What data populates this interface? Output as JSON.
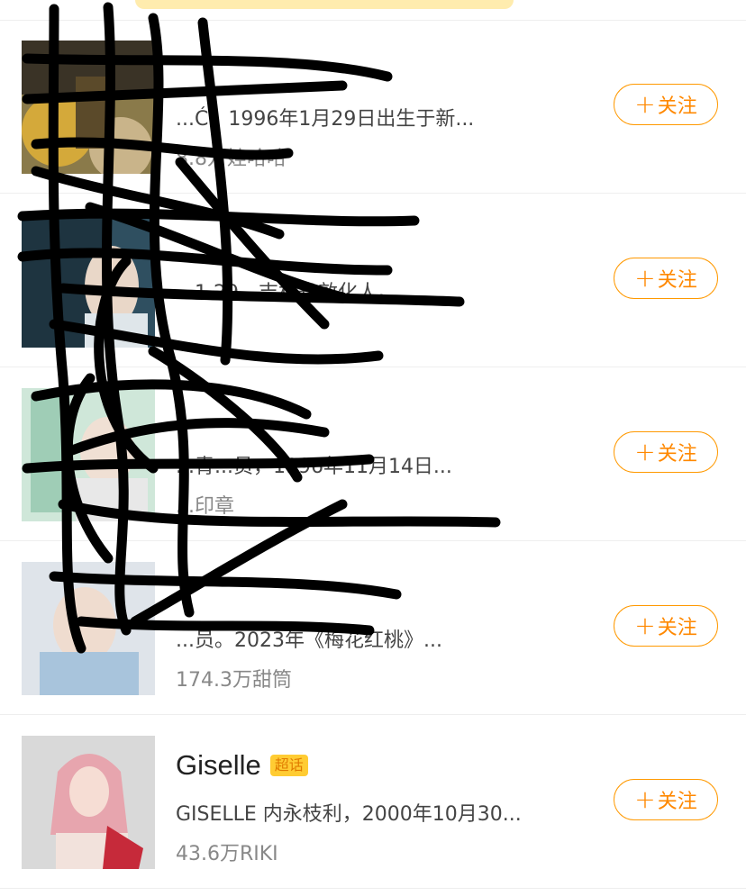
{
  "items": [
    {
      "name": "",
      "badge": "",
      "desc": "...Ć，1996年1月29日出生于新...",
      "meta": "8.8万娃哈哈",
      "follow_label": "关注"
    },
    {
      "name": "",
      "badge": "",
      "desc": "...1.29。吉林省敦化人。...",
      "meta": "",
      "follow_label": "关注"
    },
    {
      "name": "",
      "badge": "",
      "desc": "...青...员，1996年11月14日...",
      "meta": "...印章",
      "follow_label": "关注"
    },
    {
      "name": "",
      "badge": "",
      "desc": "...员。2023年《梅花红桃》...",
      "meta": "174.3万甜筒",
      "follow_label": "关注"
    },
    {
      "name": "Giselle",
      "badge": "超话",
      "desc": "GISELLE 内永枝利，2000年10月30...",
      "meta": "43.6万RIKI",
      "follow_label": "关注"
    }
  ],
  "colors": {
    "accent": "#ff9900",
    "badge_bg": "#ffcc33",
    "meta_text": "#888888"
  }
}
